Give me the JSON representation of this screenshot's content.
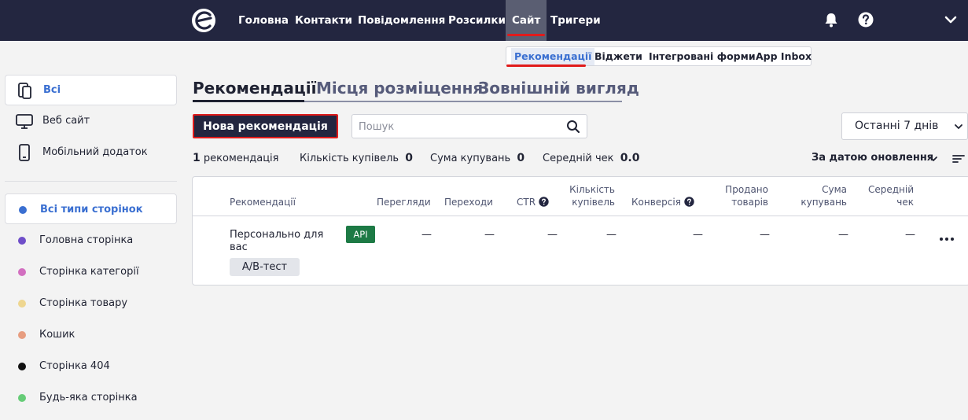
{
  "nav": {
    "items": [
      {
        "label": "Головна"
      },
      {
        "label": "Контакти"
      },
      {
        "label": "Повідомлення"
      },
      {
        "label": "Розсилки"
      },
      {
        "label": "Сайт"
      },
      {
        "label": "Тригери"
      }
    ]
  },
  "subnav": {
    "items": [
      {
        "label": "Рекомендації"
      },
      {
        "label": "Віджети"
      },
      {
        "label": "Інтегровані форми"
      },
      {
        "label": "App Inbox"
      }
    ]
  },
  "sidebar": {
    "platforms": [
      {
        "label": "Всі",
        "icon": "devices-icon"
      },
      {
        "label": "Веб сайт",
        "icon": "monitor-icon"
      },
      {
        "label": "Мобільний додаток",
        "icon": "mobile-icon"
      }
    ],
    "page_types": [
      {
        "label": "Всі типи сторінок",
        "color": "#3a6fd1"
      },
      {
        "label": "Головна сторінка",
        "color": "#6f4ec9"
      },
      {
        "label": "Сторінка категорії",
        "color": "#d26fc0"
      },
      {
        "label": "Сторінка товару",
        "color": "#eed690"
      },
      {
        "label": "Кошик",
        "color": "#e79d80"
      },
      {
        "label": "Сторінка 404",
        "color": "#111111"
      },
      {
        "label": "Будь-яка сторінка",
        "color": "#66cc77"
      }
    ]
  },
  "tabs": [
    {
      "label": "Рекомендації"
    },
    {
      "label": "Місця розміщення"
    },
    {
      "label": "Зовнішній вигляд"
    }
  ],
  "toolbar": {
    "new_label": "Нова рекомендація",
    "search_placeholder": "Пошук",
    "period": "Останні 7 днів"
  },
  "stats": {
    "count": "1",
    "count_label": "рекомендація",
    "purchases_label": "Кількість купівель",
    "purchases": "0",
    "sum_label": "Сума купувань",
    "sum": "0",
    "avg_label": "Середній чек",
    "avg": "0.0",
    "sort_label": "За датою оновлення"
  },
  "table": {
    "headers": {
      "name": "Рекомендації",
      "views": "Перегляди",
      "clicks": "Переходи",
      "ctr": "CTR",
      "purchases_1": "Кількість",
      "purchases_2": "купівель",
      "conversion": "Конверсія",
      "sold_1": "Продано",
      "sold_2": "товарів",
      "sum_1": "Сума",
      "sum_2": "купувань",
      "avg_1": "Середній",
      "avg_2": "чек"
    },
    "rows": [
      {
        "name": "Персонально для вас",
        "api": "API",
        "ab": "А/В-тест",
        "views": "—",
        "clicks": "—",
        "ctr": "—",
        "purchases": "—",
        "conversion": "—",
        "sold": "—",
        "sum": "—",
        "avg": "—"
      }
    ]
  }
}
